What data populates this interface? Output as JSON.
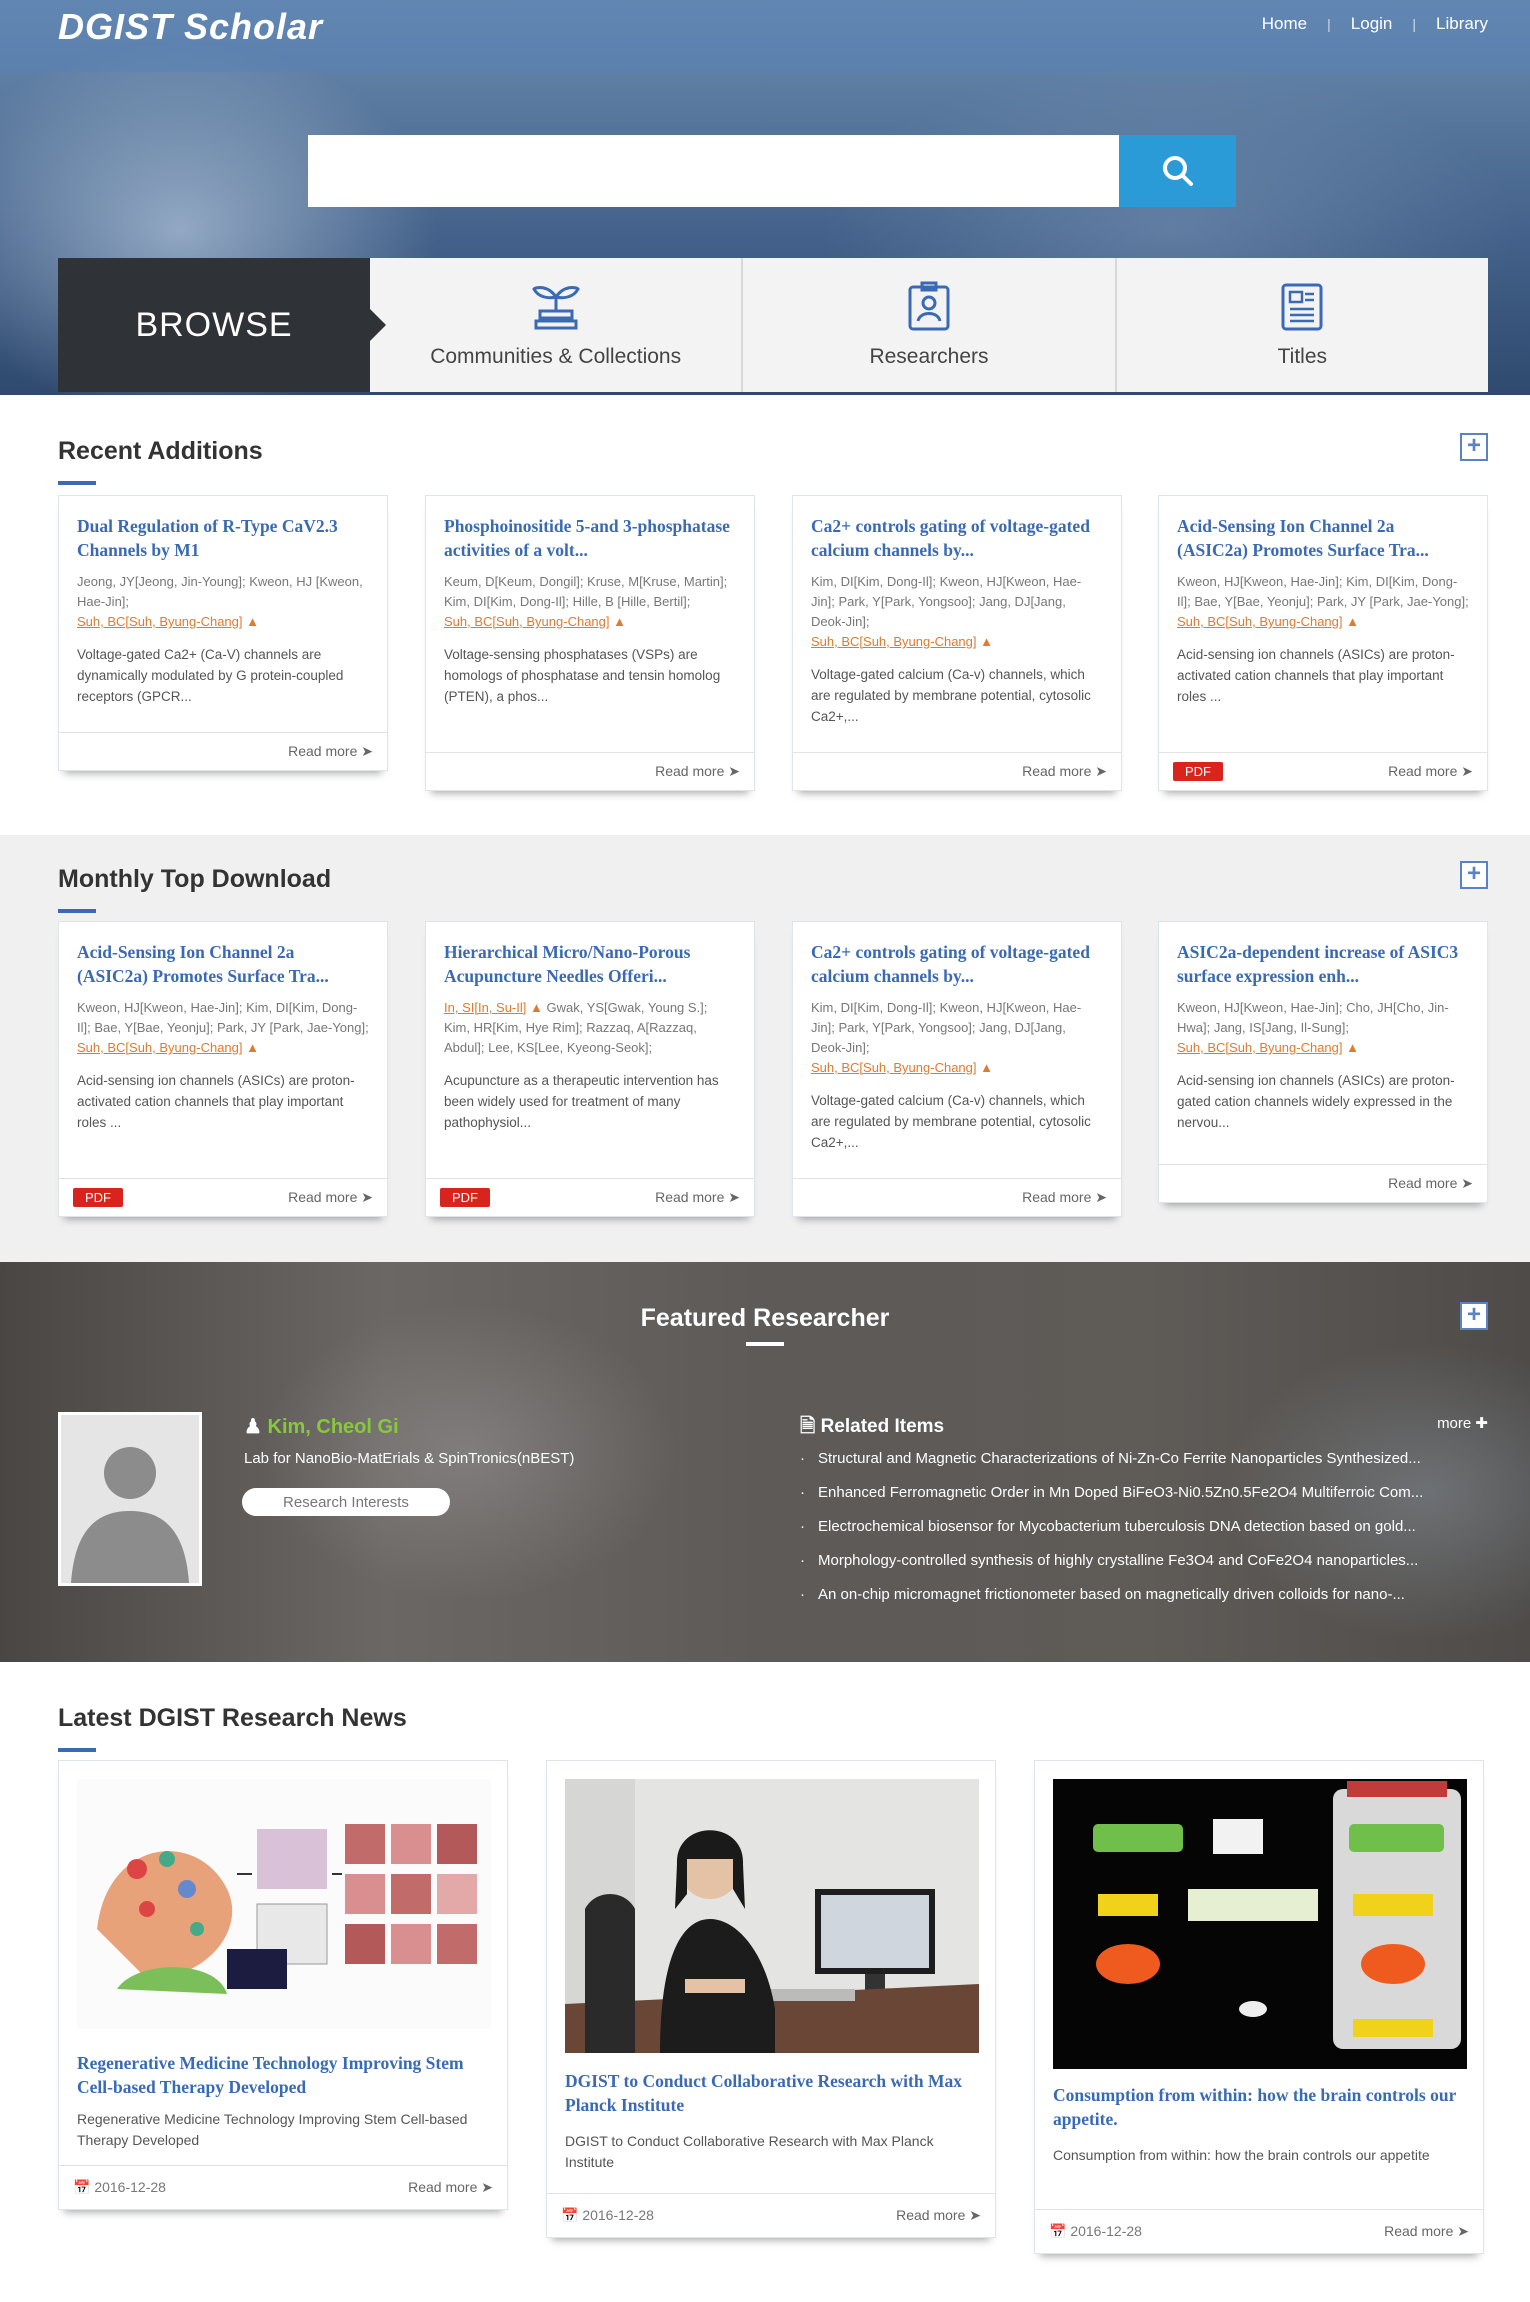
{
  "header": {
    "logo": "DGIST Scholar",
    "nav": [
      "Home",
      "Login",
      "Library"
    ]
  },
  "search": {
    "placeholder": "",
    "value": ""
  },
  "browse": {
    "label": "BROWSE",
    "tabs": [
      {
        "label": "Communities & Collections",
        "icon": "sprout-icon"
      },
      {
        "label": "Researchers",
        "icon": "id-badge-icon"
      },
      {
        "label": "Titles",
        "icon": "document-icon"
      }
    ]
  },
  "recent": {
    "title": "Recent Additions",
    "cards": [
      {
        "title": "Dual Regulation of R-Type CaV2.3 Channels by M1",
        "authors": "Jeong, JY[Jeong, Jin-Young]; Kweon, HJ [Kweon, Hae-Jin];",
        "pi": "Suh, BC[Suh, Byung-Chang]",
        "abstract": "Voltage-gated Ca2+ (Ca-V) channels are dynamically modulated by G protein-coupled receptors (GPCR...",
        "pdf": "",
        "read_more": "Read more"
      },
      {
        "title": "Phosphoinositide 5-and 3-phosphatase activities of a volt...",
        "authors": "Keum, D[Keum, Dongil]; Kruse, M[Kruse, Martin]; Kim, DI[Kim, Dong-Il]; Hille, B [Hille, Bertil];",
        "pi": "Suh, BC[Suh, Byung-Chang]",
        "abstract": "Voltage-sensing phosphatases (VSPs) are homologs of phosphatase and tensin homolog (PTEN), a phos...",
        "pdf": "",
        "read_more": "Read more"
      },
      {
        "title": "Ca2+ controls gating of voltage-gated calcium channels by...",
        "authors": "Kim, DI[Kim, Dong-Il]; Kweon, HJ[Kweon, Hae-Jin]; Park, Y[Park, Yongsoo]; Jang, DJ[Jang, Deok-Jin];",
        "pi": "Suh, BC[Suh, Byung-Chang]",
        "abstract": "Voltage-gated calcium (Ca-v) channels, which are regulated by membrane potential, cytosolic Ca2+,...",
        "pdf": "",
        "read_more": "Read more"
      },
      {
        "title": "Acid-Sensing Ion Channel 2a (ASIC2a) Promotes Surface Tra...",
        "authors": "Kweon, HJ[Kweon, Hae-Jin]; Kim, DI[Kim, Dong-Il]; Bae, Y[Bae, Yeonju]; Park, JY [Park, Jae-Yong];",
        "pi": "Suh, BC[Suh, Byung-Chang]",
        "abstract": "Acid-sensing ion channels (ASICs) are proton-activated cation channels that play important roles ...",
        "pdf": "PDF",
        "read_more": "Read more"
      }
    ]
  },
  "monthly": {
    "title": "Monthly Top Download",
    "cards": [
      {
        "title": "Acid-Sensing Ion Channel 2a (ASIC2a) Promotes Surface Tra...",
        "authors": "Kweon, HJ[Kweon, Hae-Jin]; Kim, DI[Kim, Dong-Il]; Bae, Y[Bae, Yeonju]; Park, JY [Park, Jae-Yong];",
        "pi": "Suh, BC[Suh, Byung-Chang]",
        "abstract": "Acid-sensing ion channels (ASICs) are proton-activated cation channels that play important roles ...",
        "pdf": "PDF",
        "read_more": "Read more"
      },
      {
        "title": "Hierarchical Micro/Nano-Porous Acupuncture Needles Offeri...",
        "authors": "Gwak, YS[Gwak, Young S.]; Kim, HR[Kim, Hye Rim]; Razzaq, A[Razzaq, Abdul]; Lee, KS[Lee, Kyeong-Seok];",
        "pi": "In, SI[In, Su-Il]",
        "abstract": "Acupuncture as a therapeutic intervention has been widely used for treatment of many pathophysiol...",
        "pdf": "PDF",
        "read_more": "Read more"
      },
      {
        "title": "Ca2+ controls gating of voltage-gated calcium channels by...",
        "authors": "Kim, DI[Kim, Dong-Il]; Kweon, HJ[Kweon, Hae-Jin]; Park, Y[Park, Yongsoo]; Jang, DJ[Jang, Deok-Jin];",
        "pi": "Suh, BC[Suh, Byung-Chang]",
        "abstract": "Voltage-gated calcium (Ca-v) channels, which are regulated by membrane potential, cytosolic Ca2+,...",
        "pdf": "",
        "read_more": "Read more"
      },
      {
        "title": "ASIC2a-dependent increase of ASIC3 surface expression enh...",
        "authors": "Kweon, HJ[Kweon, Hae-Jin]; Cho, JH[Cho, Jin-Hwa]; Jang, IS[Jang, Il-Sung];",
        "pi": "Suh, BC[Suh, Byung-Chang]",
        "abstract": "Acid-sensing ion channels (ASICs) are proton-gated cation channels widely expressed in the nervou...",
        "pdf": "",
        "read_more": "Read more"
      }
    ]
  },
  "featured": {
    "title": "Featured Researcher",
    "name": "Kim, Cheol Gi",
    "lab": "Lab for NanoBio-MatErials & SpinTronics(nBEST)",
    "button": "Research Interests",
    "related_title": "Related Items",
    "more": "more",
    "items": [
      "Structural and Magnetic Characterizations of Ni-Zn-Co Ferrite Nanoparticles Synthesized...",
      "Enhanced Ferromagnetic Order in Mn Doped BiFeO3-Ni0.5Zn0.5Fe2O4 Multiferroic Com...",
      "Electrochemical biosensor for Mycobacterium tuberculosis DNA detection based on gold...",
      "Morphology-controlled synthesis of highly crystalline Fe3O4 and CoFe2O4 nanoparticles...",
      "An on-chip micromagnet frictionometer based on magnetically driven colloids for nano-..."
    ]
  },
  "news": {
    "title": "Latest DGIST Research News",
    "items": [
      {
        "title": "Regenerative Medicine Technology Improving Stem Cell-based Therapy Developed",
        "summary": "Regenerative Medicine Technology Improving Stem Cell-based Therapy Developed",
        "date": "2016-12-28",
        "read_more": "Read more",
        "image": "research-figure"
      },
      {
        "title": "DGIST to Conduct Collaborative Research with Max Planck Institute",
        "summary": "DGIST to Conduct Collaborative Research with Max Planck Institute",
        "date": "2016-12-28",
        "read_more": "Read more",
        "image": "researcher-photo"
      },
      {
        "title": "Consumption from within: how the brain controls our appetite.",
        "summary": "Consumption from within: how the brain controls our appetite",
        "date": "2016-12-28",
        "read_more": "Read more",
        "image": "diagram-figure"
      }
    ]
  },
  "colors": {
    "accent": "#3a6ab3",
    "search_button": "#2a9bd6",
    "pi_orange": "#e07a2e",
    "featured_name": "#86c93a",
    "pdf_red": "#d8241c"
  }
}
